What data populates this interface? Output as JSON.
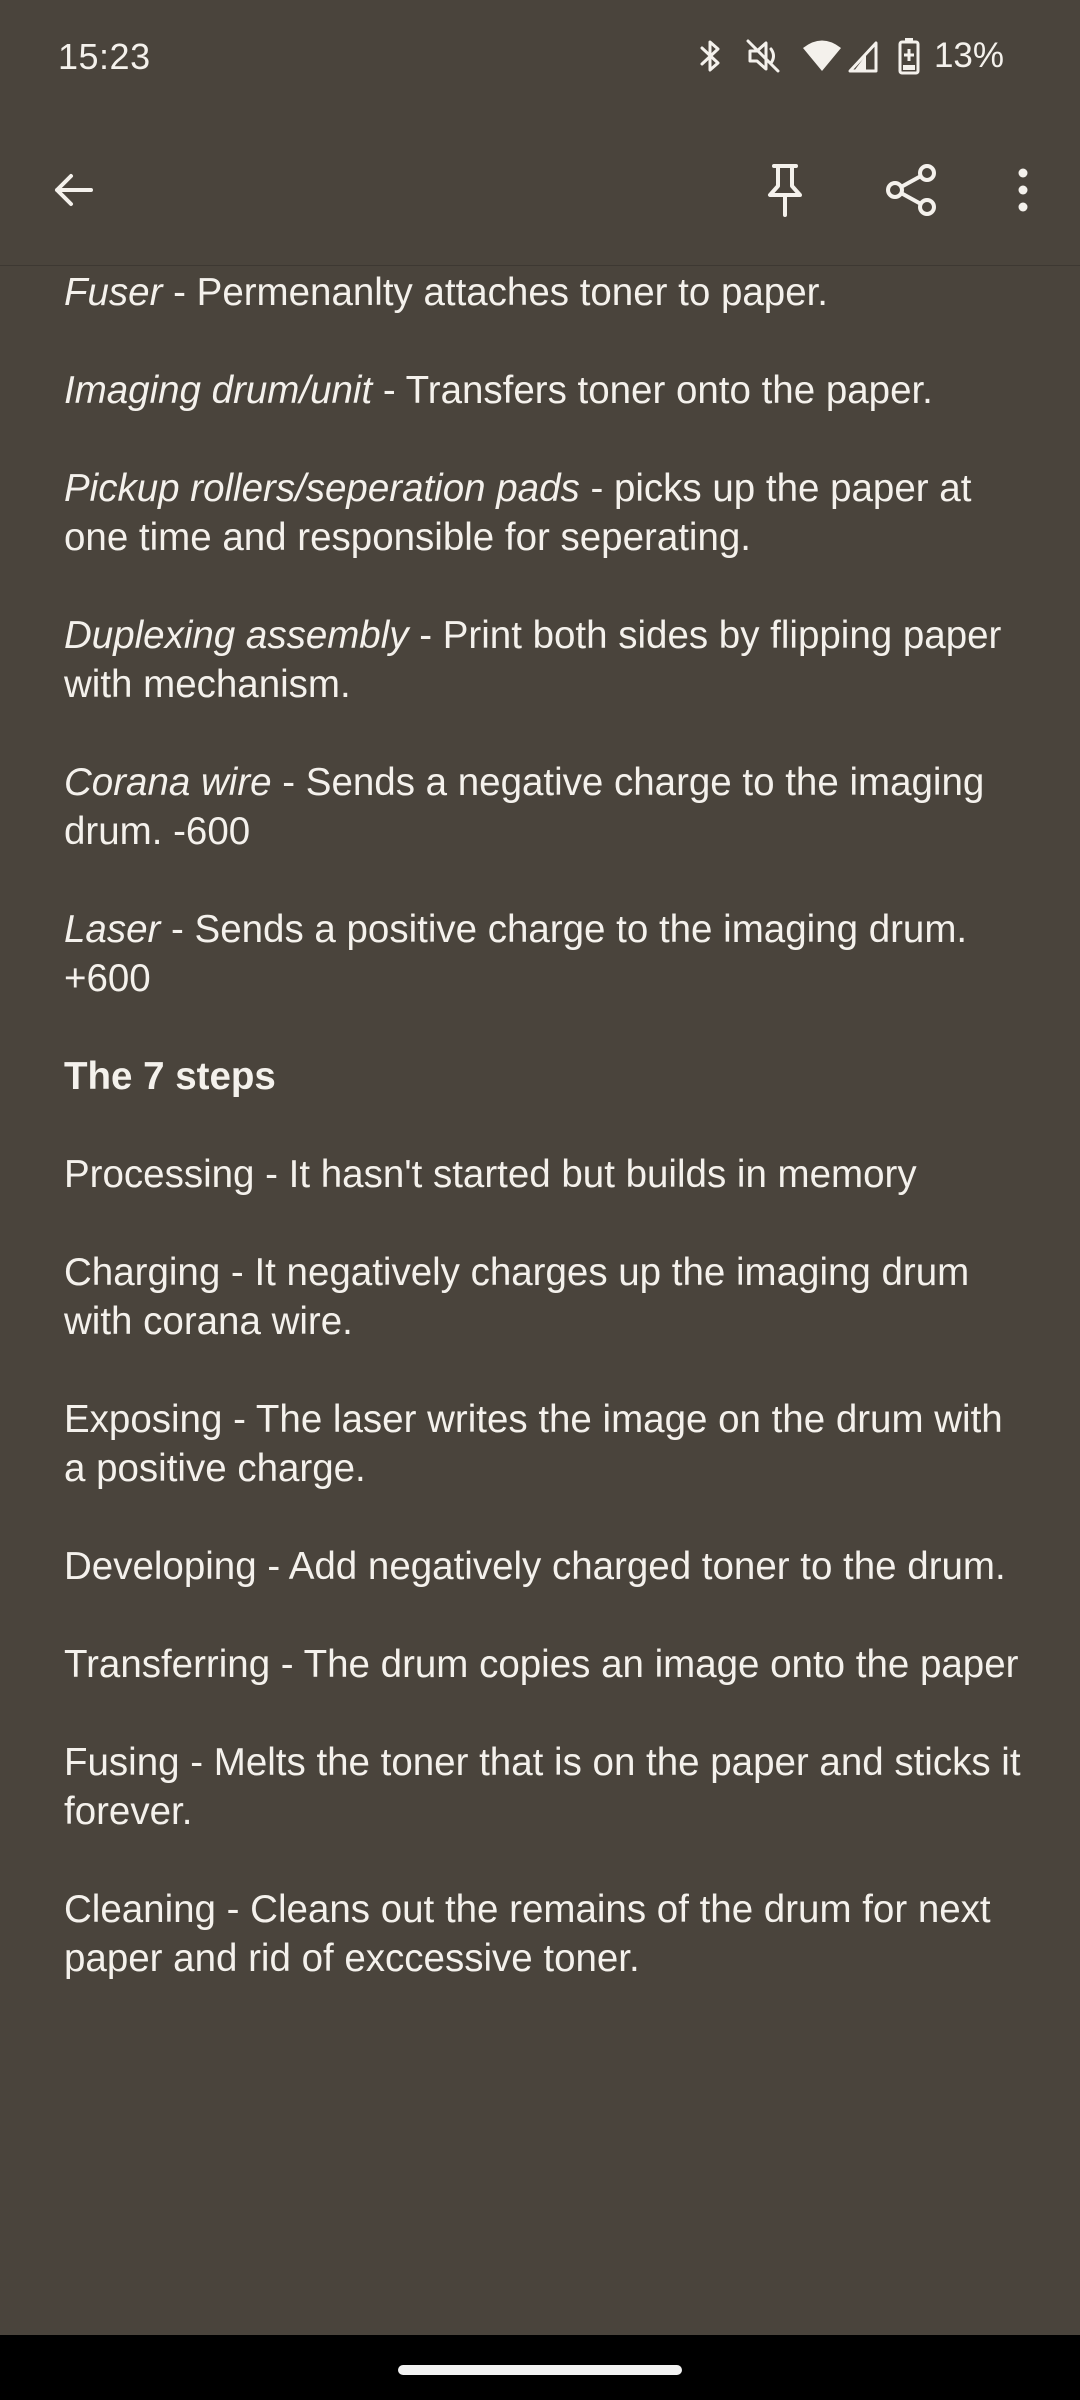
{
  "status_bar": {
    "time": "15:23",
    "battery_percent": "13%",
    "icons": [
      "bluetooth-icon",
      "mute-icon",
      "wifi-icon",
      "signal-icon",
      "battery-icon"
    ]
  },
  "toolbar": {
    "icons": [
      "back-arrow-icon",
      "pin-icon",
      "share-icon",
      "more-vert-icon"
    ]
  },
  "note": {
    "definitions": [
      {
        "term": "Fuser",
        "desc": " - Permenanlty attaches toner to paper."
      },
      {
        "term": "Imaging drum/unit",
        "desc": " - Transfers toner onto the paper."
      },
      {
        "term": "Pickup rollers/seperation pads",
        "desc": " - picks up the paper at one time and responsible for seperating."
      },
      {
        "term": "Duplexing assembly",
        "desc": " - Print both sides by flipping paper with mechanism."
      },
      {
        "term": "Corana wire",
        "desc": " - Sends a negative charge to the imaging drum. -600"
      },
      {
        "term": "Laser",
        "desc": " - Sends a positive charge to the imaging drum. +600"
      }
    ],
    "heading": "The 7 steps",
    "steps": [
      "Processing - It hasn't started but builds in memory",
      "Charging - It negatively charges up the imaging drum with corana wire.",
      "Exposing - The laser writes the image on the drum with a positive charge.",
      "Developing - Add negatively charged toner to the drum.",
      "Transferring - The drum copies an image onto the paper",
      "Fusing - Melts the toner that is on the paper and sticks it forever.",
      "Cleaning - Cleans out the remains of the drum for next paper and rid of exccessive toner."
    ]
  },
  "colors": {
    "background": "#4a443c",
    "text": "#f4f1ec",
    "nav_bar": "#000000"
  }
}
